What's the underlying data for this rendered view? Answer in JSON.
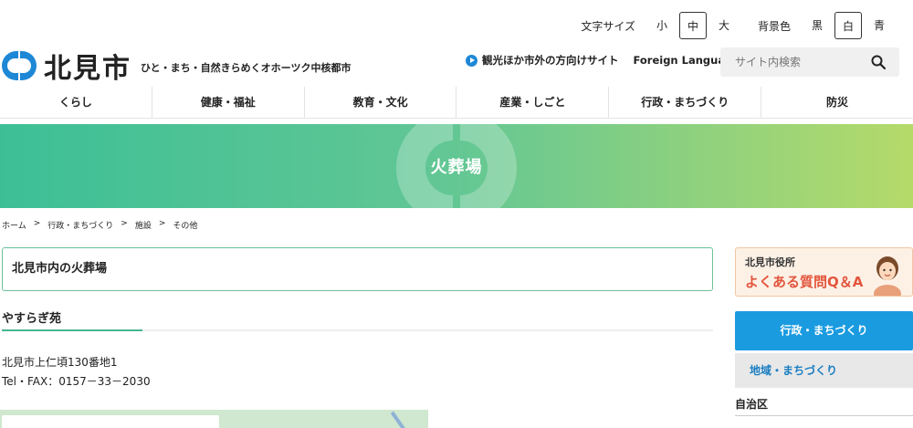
{
  "util": {
    "text_size_label": "文字サイズ",
    "text_sizes": [
      "小",
      "中",
      "大"
    ],
    "text_size_selected": "中",
    "bg_label": "背景色",
    "bg_colors": [
      "黒",
      "白",
      "青"
    ],
    "bg_selected": "白"
  },
  "header": {
    "logo_name": "北見市",
    "tagline": "ひと・まち・自然きらめくオホーツク中核都市",
    "tourism_link": "観光ほか市外の方向けサイト",
    "foreign_link": "Foreign Language",
    "search_placeholder": "サイト内検索",
    "accent": "#1e88d6"
  },
  "nav": {
    "items": [
      "くらし",
      "健康・福祉",
      "教育・文化",
      "産業・しごと",
      "行政・まちづくり",
      "防災"
    ]
  },
  "banner": {
    "title": "火葬場"
  },
  "breadcrumb": {
    "items": [
      "ホーム",
      "行政・まちづくり",
      "施設",
      "その他"
    ],
    "separator": ">"
  },
  "main": {
    "heading": "北見市内の火葬場",
    "subheading": "やすらぎ苑",
    "address": "北見市上仁頃130番地1",
    "phone": "Tel・FAX：0157－33－2030"
  },
  "sidebar": {
    "faq_line1": "北見市役所",
    "faq_line2": "よくある質問Q＆A",
    "category_title": "行政・まちづくり",
    "category_sub": "地域・まちづくり",
    "section_heading": "自治区"
  }
}
